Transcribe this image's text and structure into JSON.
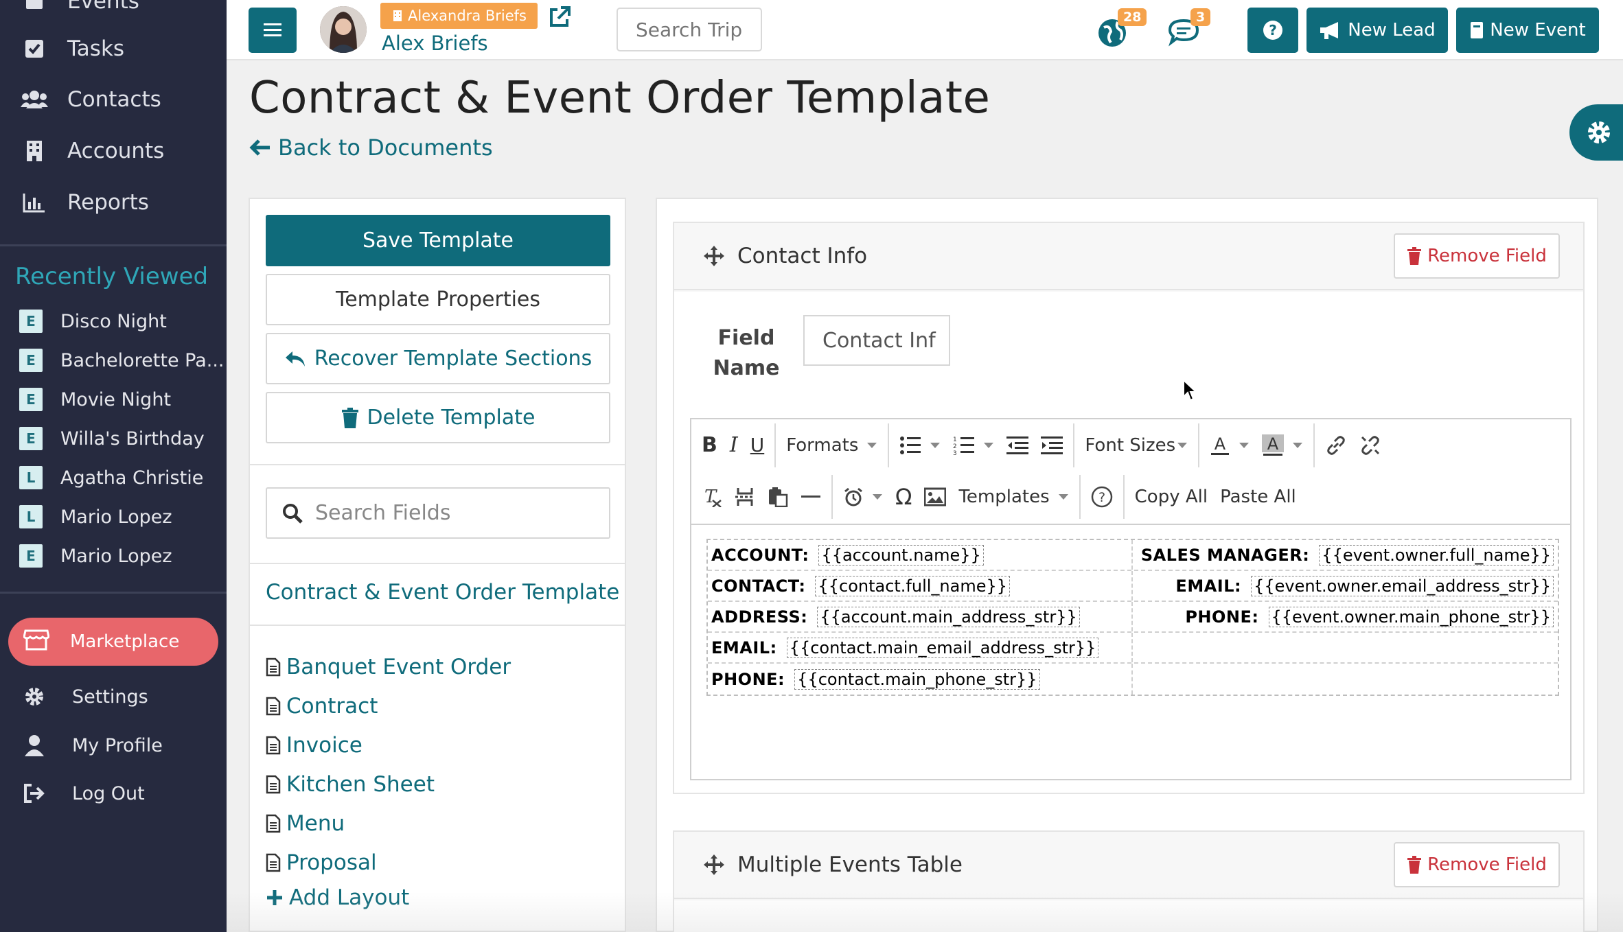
{
  "sidebar": {
    "top_partial": "Events",
    "nav": [
      "Tasks",
      "Contacts",
      "Accounts",
      "Reports"
    ],
    "recently_viewed_title": "Recently Viewed",
    "recent": [
      {
        "badge": "E",
        "label": "Disco Night"
      },
      {
        "badge": "E",
        "label": "Bachelorette Pa..."
      },
      {
        "badge": "E",
        "label": "Movie Night"
      },
      {
        "badge": "E",
        "label": "Willa's Birthday"
      },
      {
        "badge": "L",
        "label": "Agatha Christie"
      },
      {
        "badge": "L",
        "label": "Mario Lopez"
      },
      {
        "badge": "E",
        "label": "Mario Lopez"
      }
    ],
    "marketplace": "Marketplace",
    "bottom": [
      "Settings",
      "My Profile",
      "Log Out"
    ],
    "accent_color": "#e8666b"
  },
  "topbar": {
    "user_badge": "Alexandra Briefs",
    "user_name": "Alex Briefs",
    "search_placeholder": "Search Trip",
    "notif_count_1": "28",
    "notif_count_2": "3",
    "help": "?",
    "new_lead": "New Lead",
    "new_event": "New Event",
    "brand_color": "#0f6b7b"
  },
  "page": {
    "title": "Contract & Event Order Template",
    "back": "Back to Documents"
  },
  "left_panel": {
    "save": "Save Template",
    "properties": "Template Properties",
    "recover": "Recover Template Sections",
    "delete": "Delete Template",
    "search_placeholder": "Search Fields",
    "template_name": "Contract & Event Order Template",
    "layouts": [
      "Banquet Event Order",
      "Contract",
      "Invoice",
      "Kitchen Sheet",
      "Menu",
      "Proposal"
    ],
    "add_layout": "Add Layout"
  },
  "fields": {
    "card1": {
      "title": "Contact Info",
      "remove": "Remove Field",
      "field_name_label": "Field Name",
      "field_name_value": "Contact Inf"
    },
    "card2": {
      "title": "Multiple Events Table",
      "remove": "Remove Field"
    }
  },
  "editor": {
    "formats": "Formats",
    "font_sizes": "Font Sizes",
    "templates": "Templates",
    "copy_all": "Copy All",
    "paste_all": "Paste All",
    "rows": [
      {
        "l_label": "ACCOUNT:",
        "l_tag": "{{account.name}}",
        "r_label": "SALES MANAGER:",
        "r_tag": "{{event.owner.full_name}}"
      },
      {
        "l_label": "CONTACT:",
        "l_tag": "{{contact.full_name}}",
        "r_label": "EMAIL:",
        "r_tag": "{{event.owner.email_address_str}}"
      },
      {
        "l_label": "ADDRESS:",
        "l_tag": "{{account.main_address_str}}",
        "r_label": "PHONE:",
        "r_tag": "{{event.owner.main_phone_str}}"
      },
      {
        "l_label": "EMAIL:",
        "l_tag": "{{contact.main_email_address_str}}",
        "r_label": "",
        "r_tag": ""
      },
      {
        "l_label": "PHONE:",
        "l_tag": "{{contact.main_phone_str}}",
        "r_label": "",
        "r_tag": ""
      }
    ]
  }
}
